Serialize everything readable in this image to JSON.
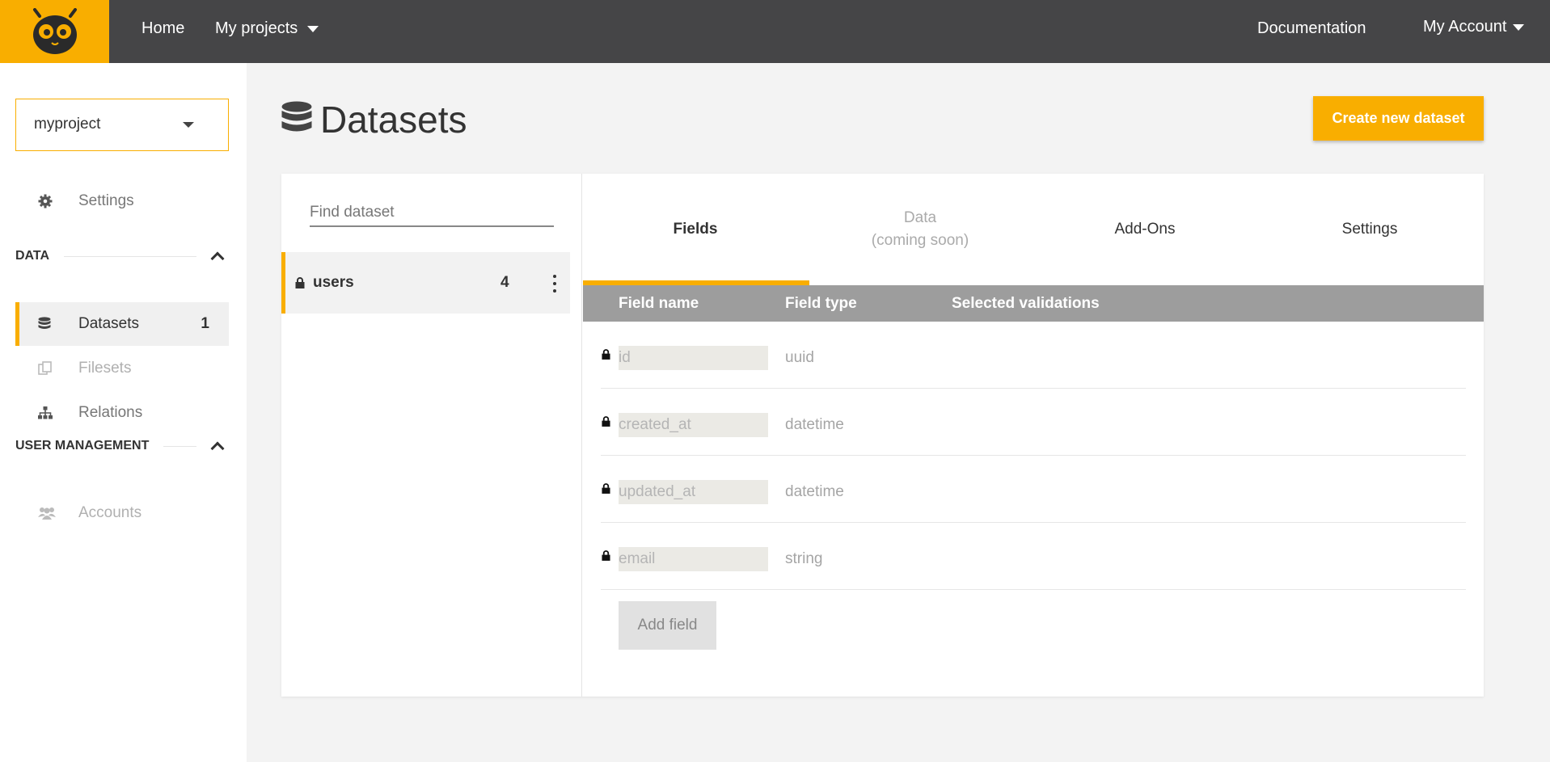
{
  "topbar": {
    "logo_icon": "owl-logo-icon",
    "nav": {
      "home": "Home",
      "my_projects": "My projects"
    },
    "right": {
      "documentation": "Documentation",
      "my_account": "My Account"
    }
  },
  "sidebar": {
    "project_select": {
      "value": "myproject"
    },
    "settings": {
      "label": "Settings",
      "icon": "gear-icon"
    },
    "sections": {
      "data": {
        "title": "DATA"
      },
      "user_management": {
        "title": "USER MANAGEMENT"
      }
    },
    "items": [
      {
        "label": "Datasets",
        "count": "1",
        "icon": "database-icon",
        "active": true
      },
      {
        "label": "Filesets",
        "icon": "files-icon",
        "disabled": true
      },
      {
        "label": "Relations",
        "icon": "sitemap-icon"
      },
      {
        "label": "Accounts",
        "icon": "users-icon",
        "disabled": true
      }
    ]
  },
  "main": {
    "title": "Datasets",
    "title_icon": "database-icon",
    "create_button": "Create new dataset",
    "search": {
      "placeholder": "Find dataset",
      "value": ""
    },
    "datasets": [
      {
        "name": "users",
        "count": "4",
        "locked": true
      }
    ],
    "tabs": [
      {
        "label": "Fields",
        "active": true
      },
      {
        "label": "Data",
        "sublabel": "(coming soon)",
        "disabled": true
      },
      {
        "label": "Add-Ons"
      },
      {
        "label": "Settings"
      }
    ],
    "table": {
      "headers": {
        "name": "Field name",
        "type": "Field type",
        "validations": "Selected validations"
      },
      "fields": [
        {
          "name": "id",
          "type": "uuid",
          "locked": true
        },
        {
          "name": "created_at",
          "type": "datetime",
          "locked": true
        },
        {
          "name": "updated_at",
          "type": "datetime",
          "locked": true
        },
        {
          "name": "email",
          "type": "string",
          "locked": true
        }
      ]
    },
    "add_field_button": "Add field"
  },
  "colors": {
    "accent": "#f9ae00",
    "topbar": "#454547",
    "table_header": "#9d9d9d"
  }
}
